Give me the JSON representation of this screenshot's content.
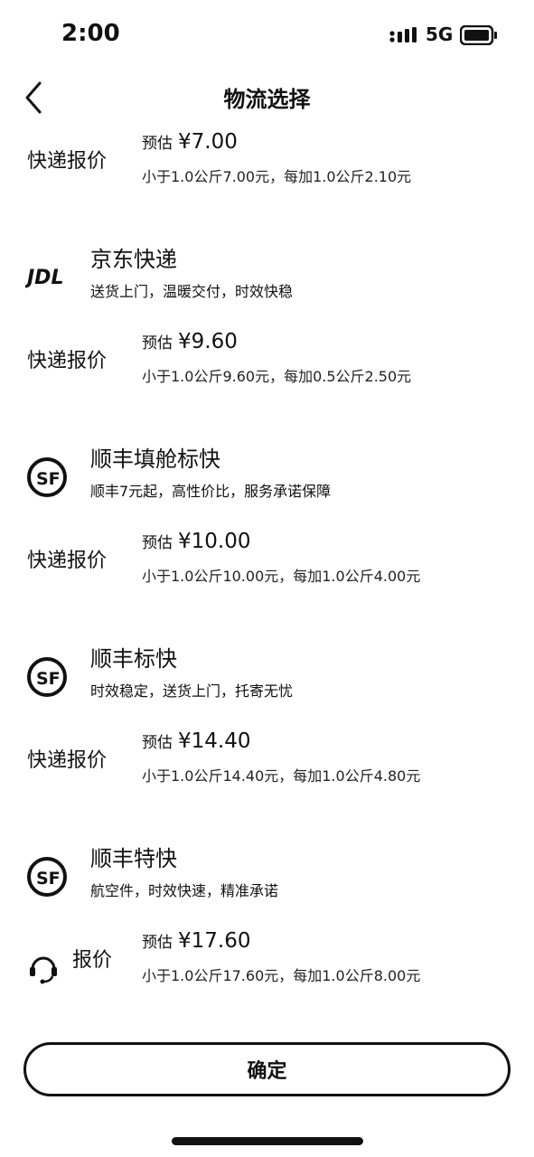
{
  "status_bar": {
    "time": "2:00",
    "network": "5G"
  },
  "nav": {
    "title": "物流选择"
  },
  "price_label": "快递报价",
  "estimate_prefix": "预估",
  "price_blocks": [
    {
      "price": "¥7.00",
      "detail": "小于1.0公斤7.00元，每加1.0公斤2.10元"
    },
    {
      "price": "¥9.60",
      "detail": "小于1.0公斤9.60元，每加0.5公斤2.50元"
    },
    {
      "price": "¥10.00",
      "detail": "小于1.0公斤10.00元，每加1.0公斤4.00元"
    },
    {
      "price": "¥14.40",
      "detail": "小于1.0公斤14.40元，每加1.0公斤4.80元"
    },
    {
      "price": "¥17.60",
      "detail": "小于1.0公斤17.60元，每加1.0公斤8.00元"
    }
  ],
  "carriers": [
    {
      "logo_text": "JDL",
      "name": "京东快递",
      "desc": "送货上门，温暖交付，时效快稳"
    },
    {
      "logo_text": "SF",
      "name": "顺丰填舱标快",
      "desc": "顺丰7元起，高性价比，服务承诺保障"
    },
    {
      "logo_text": "SF",
      "name": "顺丰标快",
      "desc": "时效稳定，送货上门，托寄无忧"
    },
    {
      "logo_text": "SF",
      "name": "顺丰特快",
      "desc": "航空件，时效快速，精准承诺"
    }
  ],
  "last_price_label": "报价",
  "confirm": "确定"
}
